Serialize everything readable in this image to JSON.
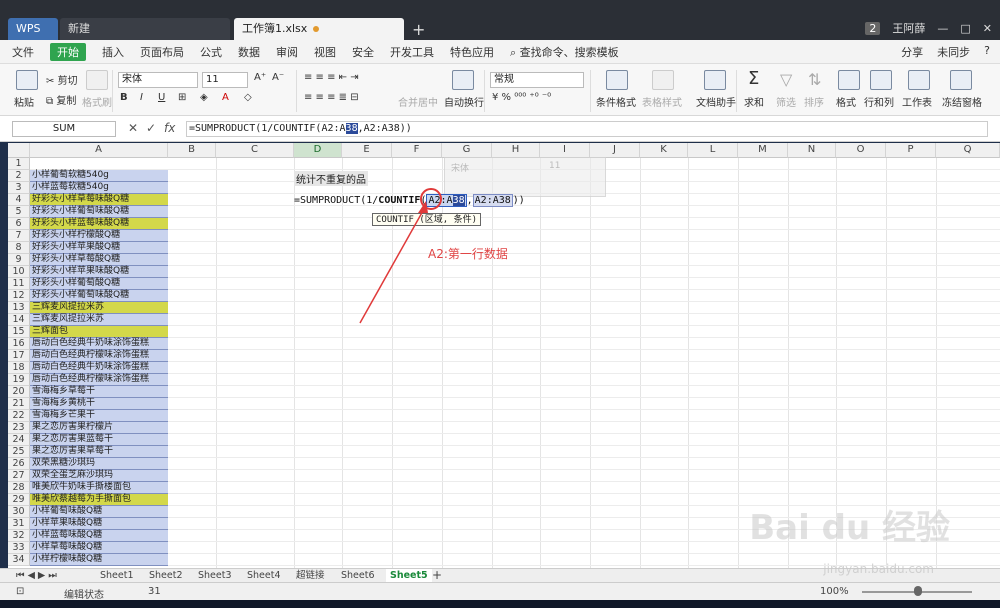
{
  "tabs": {
    "wps": "WPS",
    "new": "新建",
    "book": "工作簿1.xlsx"
  },
  "titlebar_right": {
    "badge": "2",
    "user": "王阿薛"
  },
  "menu": [
    "文件",
    "开始",
    "插入",
    "页面布局",
    "公式",
    "数据",
    "审阅",
    "视图",
    "安全",
    "开发工具",
    "特色应用"
  ],
  "menu_search": "查找命令、搜索模板",
  "menu_right": {
    "share": "分享",
    "sync": "未同步",
    "help": "?"
  },
  "ribbon": {
    "cut": "剪切",
    "copy": "复制",
    "paste": "粘贴",
    "format_painter": "格式刷",
    "font": "宋体",
    "size": "11",
    "merge": "合并居中",
    "wrap": "自动换行",
    "numfmt": "常规",
    "cond": "条件格式",
    "tablefmt": "表格样式",
    "doc": "文档助手",
    "sum": "求和",
    "filter": "筛选",
    "sort": "排序",
    "format": "格式",
    "rowcol": "行和列",
    "sheet": "工作表",
    "freeze": "冻结窗格"
  },
  "formula_bar": {
    "name_box": "SUM",
    "fx": "fx",
    "pre": "=SUMPRODUCT(1/COUNTIF(A2:A",
    "hl": "38",
    "post": ",A2:A38))"
  },
  "columns": [
    "A",
    "B",
    "C",
    "D",
    "E",
    "F",
    "G",
    "H",
    "I",
    "J",
    "K",
    "L",
    "M",
    "N",
    "O",
    "P",
    "Q"
  ],
  "rows": [
    {
      "n": "1",
      "a": "",
      "yellow": false
    },
    {
      "n": "2",
      "a": "小样葡萄软糖540g",
      "yellow": false
    },
    {
      "n": "3",
      "a": "小样蓝莓软糖540g",
      "yellow": false
    },
    {
      "n": "4",
      "a": "好彩头小样草莓味酸Q糖",
      "yellow": true
    },
    {
      "n": "5",
      "a": "好彩头小样葡萄味酸Q糖",
      "yellow": false
    },
    {
      "n": "6",
      "a": "好彩头小样蓝莓味酸Q糖",
      "yellow": true
    },
    {
      "n": "7",
      "a": "好彩头小样柠檬酸Q糖",
      "yellow": false
    },
    {
      "n": "8",
      "a": "好彩头小样苹果酸Q糖",
      "yellow": false
    },
    {
      "n": "9",
      "a": "好彩头小样草莓酸Q糖",
      "yellow": false
    },
    {
      "n": "10",
      "a": "好彩头小样苹果味酸Q糖",
      "yellow": false
    },
    {
      "n": "11",
      "a": "好彩头小样葡萄酸Q糖",
      "yellow": false
    },
    {
      "n": "12",
      "a": "好彩头小样葡萄味酸Q糖",
      "yellow": false
    },
    {
      "n": "13",
      "a": "三辉麦风提拉米苏",
      "yellow": true
    },
    {
      "n": "14",
      "a": "三辉麦风提拉米苏",
      "yellow": false
    },
    {
      "n": "15",
      "a": "三辉面包",
      "yellow": true
    },
    {
      "n": "16",
      "a": "唇动白色经典牛奶味涂饰蛋糕",
      "yellow": false
    },
    {
      "n": "17",
      "a": "唇动白色经典柠檬味涂饰蛋糕",
      "yellow": false
    },
    {
      "n": "18",
      "a": "唇动白色经典牛奶味涂饰蛋糕",
      "yellow": false
    },
    {
      "n": "19",
      "a": "唇动白色经典柠檬味涂饰蛋糕",
      "yellow": false
    },
    {
      "n": "20",
      "a": "雪海梅乡草莓干",
      "yellow": false
    },
    {
      "n": "21",
      "a": "雪海梅乡黄桃干",
      "yellow": false
    },
    {
      "n": "22",
      "a": "雪海梅乡芒果干",
      "yellow": false
    },
    {
      "n": "23",
      "a": "果之恋厉害果柠檬片",
      "yellow": false
    },
    {
      "n": "24",
      "a": "果之恋厉害果蓝莓干",
      "yellow": false
    },
    {
      "n": "25",
      "a": "果之恋厉害果草莓干",
      "yellow": false
    },
    {
      "n": "26",
      "a": "双荣黑糖沙琪玛",
      "yellow": false
    },
    {
      "n": "27",
      "a": "双荣全蛋芝麻沙琪玛",
      "yellow": false
    },
    {
      "n": "28",
      "a": "唯美欣牛奶味手撕楼面包",
      "yellow": false
    },
    {
      "n": "29",
      "a": "唯美欣蔡越莓为手撕面包",
      "yellow": true
    },
    {
      "n": "30",
      "a": "小样葡萄味酸Q糖",
      "yellow": false
    },
    {
      "n": "31",
      "a": "小样苹果味酸Q糖",
      "yellow": false
    },
    {
      "n": "32",
      "a": "小样蓝莓味酸Q糖",
      "yellow": false
    },
    {
      "n": "33",
      "a": "小样草莓味酸Q糖",
      "yellow": false
    },
    {
      "n": "34",
      "a": "小样柠檬味酸Q糖",
      "yellow": false
    }
  ],
  "d2_text": "统计不重复的品",
  "d4": {
    "pre": "=SUMPRODUCT(1/",
    "fn": "COUNTIF",
    "open": "(",
    "r1a": "A2:A",
    "r1b": "38",
    "comma": ",",
    "r2": "A2:A38",
    "close": "))"
  },
  "tooltip": "COUNTIF (区域, 条件)",
  "ghost_toolbar": {
    "font": "宋体",
    "size": "11"
  },
  "annotation": "A2:第一行数据",
  "sheets": [
    "Sheet1",
    "Sheet2",
    "Sheet3",
    "Sheet4",
    "超链接",
    "Sheet6",
    "Sheet5"
  ],
  "active_sheet": "Sheet5",
  "status": {
    "mode": "编辑状态",
    "value": "31",
    "zoom": "100%"
  },
  "watermark": {
    "logo": "Bai du 经验",
    "url": "jingyan.baidu.com"
  }
}
